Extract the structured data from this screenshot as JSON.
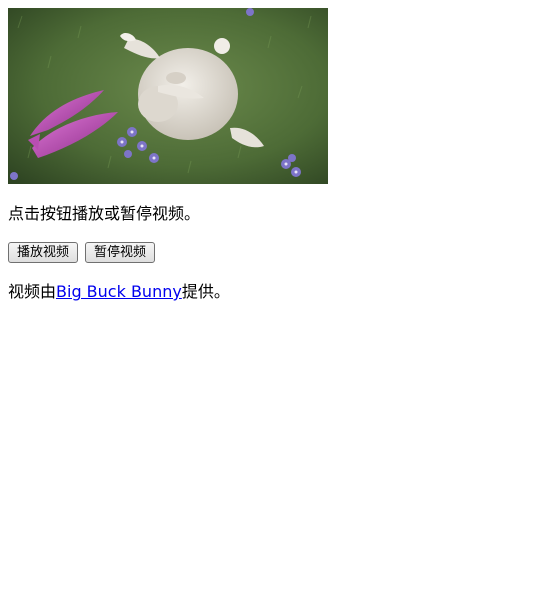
{
  "video": {
    "scene": "big-buck-bunny-frame"
  },
  "instruction": "点击按钮播放或暂停视频。",
  "buttons": {
    "play_label": "播放视频",
    "pause_label": "暂停视频"
  },
  "credit": {
    "prefix": "视频由",
    "link_text": "Big Buck Bunny",
    "suffix": "提供。"
  },
  "colors": {
    "link": "#0000ee",
    "grass": "#4a6a34"
  }
}
